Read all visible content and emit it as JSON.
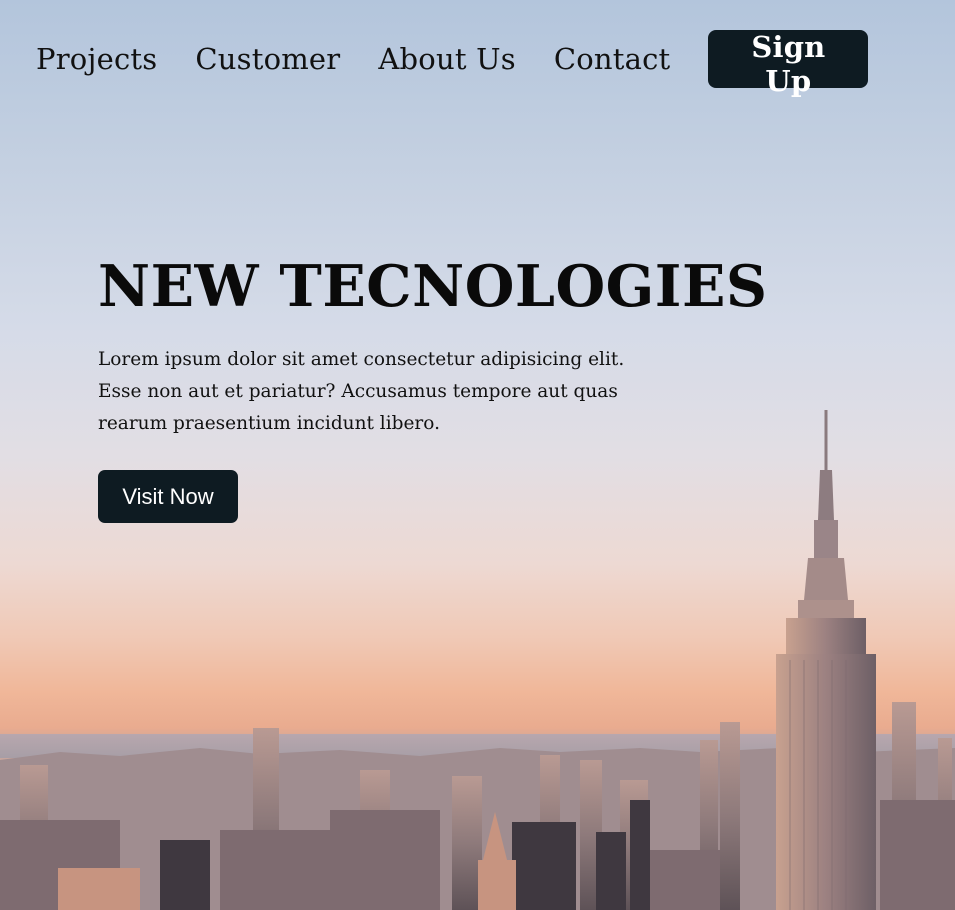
{
  "nav": {
    "items": [
      {
        "label": "Projects"
      },
      {
        "label": "Customer"
      },
      {
        "label": "About Us"
      },
      {
        "label": "Contact"
      }
    ],
    "signup_label": "Sign Up"
  },
  "hero": {
    "title": "NEW TECNOLOGIES",
    "description": "Lorem ipsum dolor sit amet consectetur adipisicing elit. Esse non aut et pariatur? Accusamus tempore aut quas rearum praesentium incidunt libero.",
    "cta_label": "Visit Now",
    "background_image": "city-skyline-sunset-photo"
  },
  "colors": {
    "button_bg": "#0e1b22",
    "button_text": "#ffffff",
    "text": "#0b0b0b",
    "sky_top": "#b3c5dc",
    "sky_horizon": "#f0b799"
  }
}
